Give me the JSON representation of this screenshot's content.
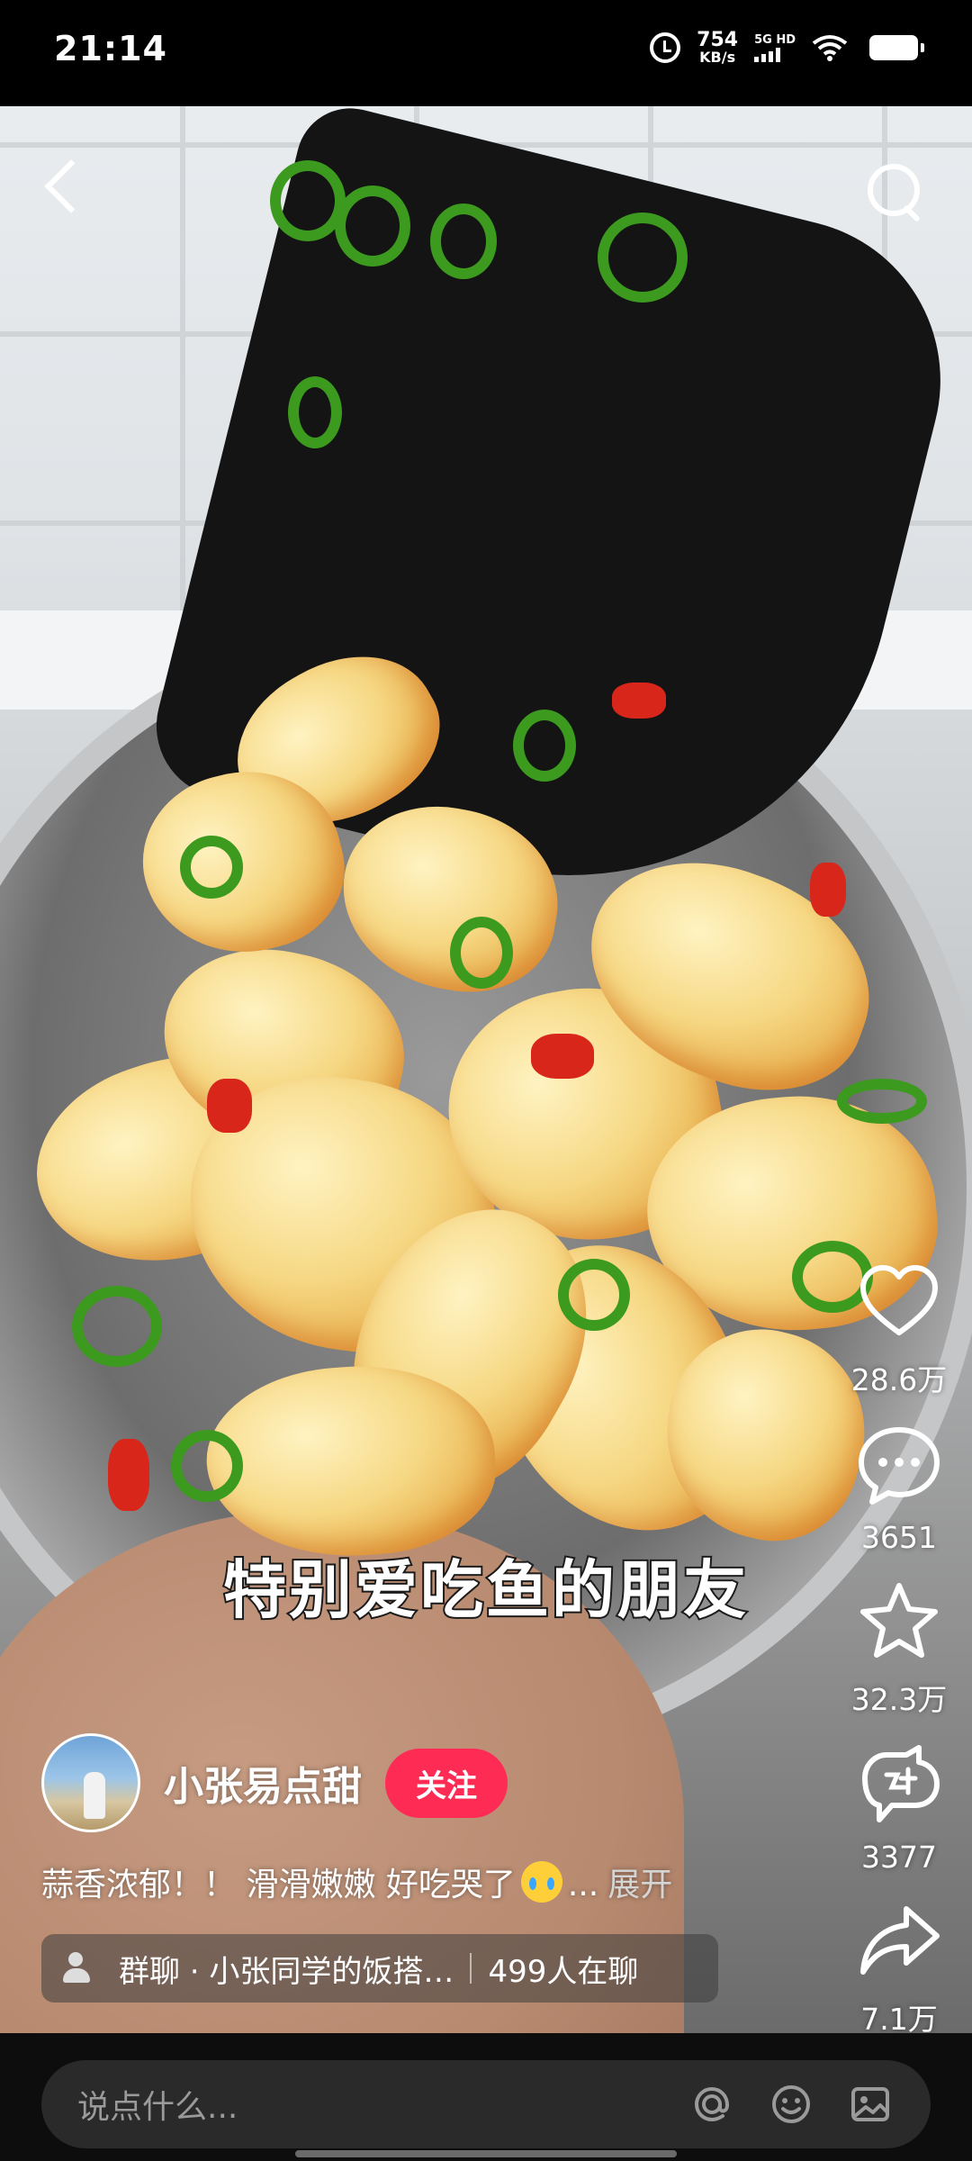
{
  "status_bar": {
    "time": "21:14",
    "net_speed_value": "754",
    "net_speed_unit": "KB/s",
    "network_tag": "5G HD",
    "icons": [
      "alarm-icon",
      "signal-icon",
      "wifi-icon",
      "battery-icon"
    ]
  },
  "video": {
    "caption": "特别爱吃鱼的朋友"
  },
  "top_bar": {
    "icons": [
      "back-icon",
      "search-icon"
    ]
  },
  "actions": {
    "like": {
      "icon": "heart-icon",
      "count": "28.6万"
    },
    "comment": {
      "icon": "comment-icon",
      "count": "3651"
    },
    "favorite": {
      "icon": "star-icon",
      "count": "32.3万"
    },
    "remix": {
      "icon": "remix-icon",
      "count": "3377"
    },
    "share": {
      "icon": "share-icon",
      "count": "7.1万"
    }
  },
  "author": {
    "name": "小张易点甜",
    "follow_label": "关注"
  },
  "description": {
    "text": "蒜香浓郁！！ 滑滑嫩嫩 好吃哭了",
    "emoji": "crying-face-emoji",
    "ellipsis": "...",
    "expand_label": "展开"
  },
  "group_chat": {
    "name": "群聊 · 小张同学的饭搭…",
    "members": "499人在聊"
  },
  "comment_bar": {
    "placeholder": "说点什么...",
    "icons": [
      "at-icon",
      "emoji-icon",
      "image-icon"
    ]
  },
  "colors": {
    "follow": "#fe2c55",
    "background": "#000000"
  }
}
